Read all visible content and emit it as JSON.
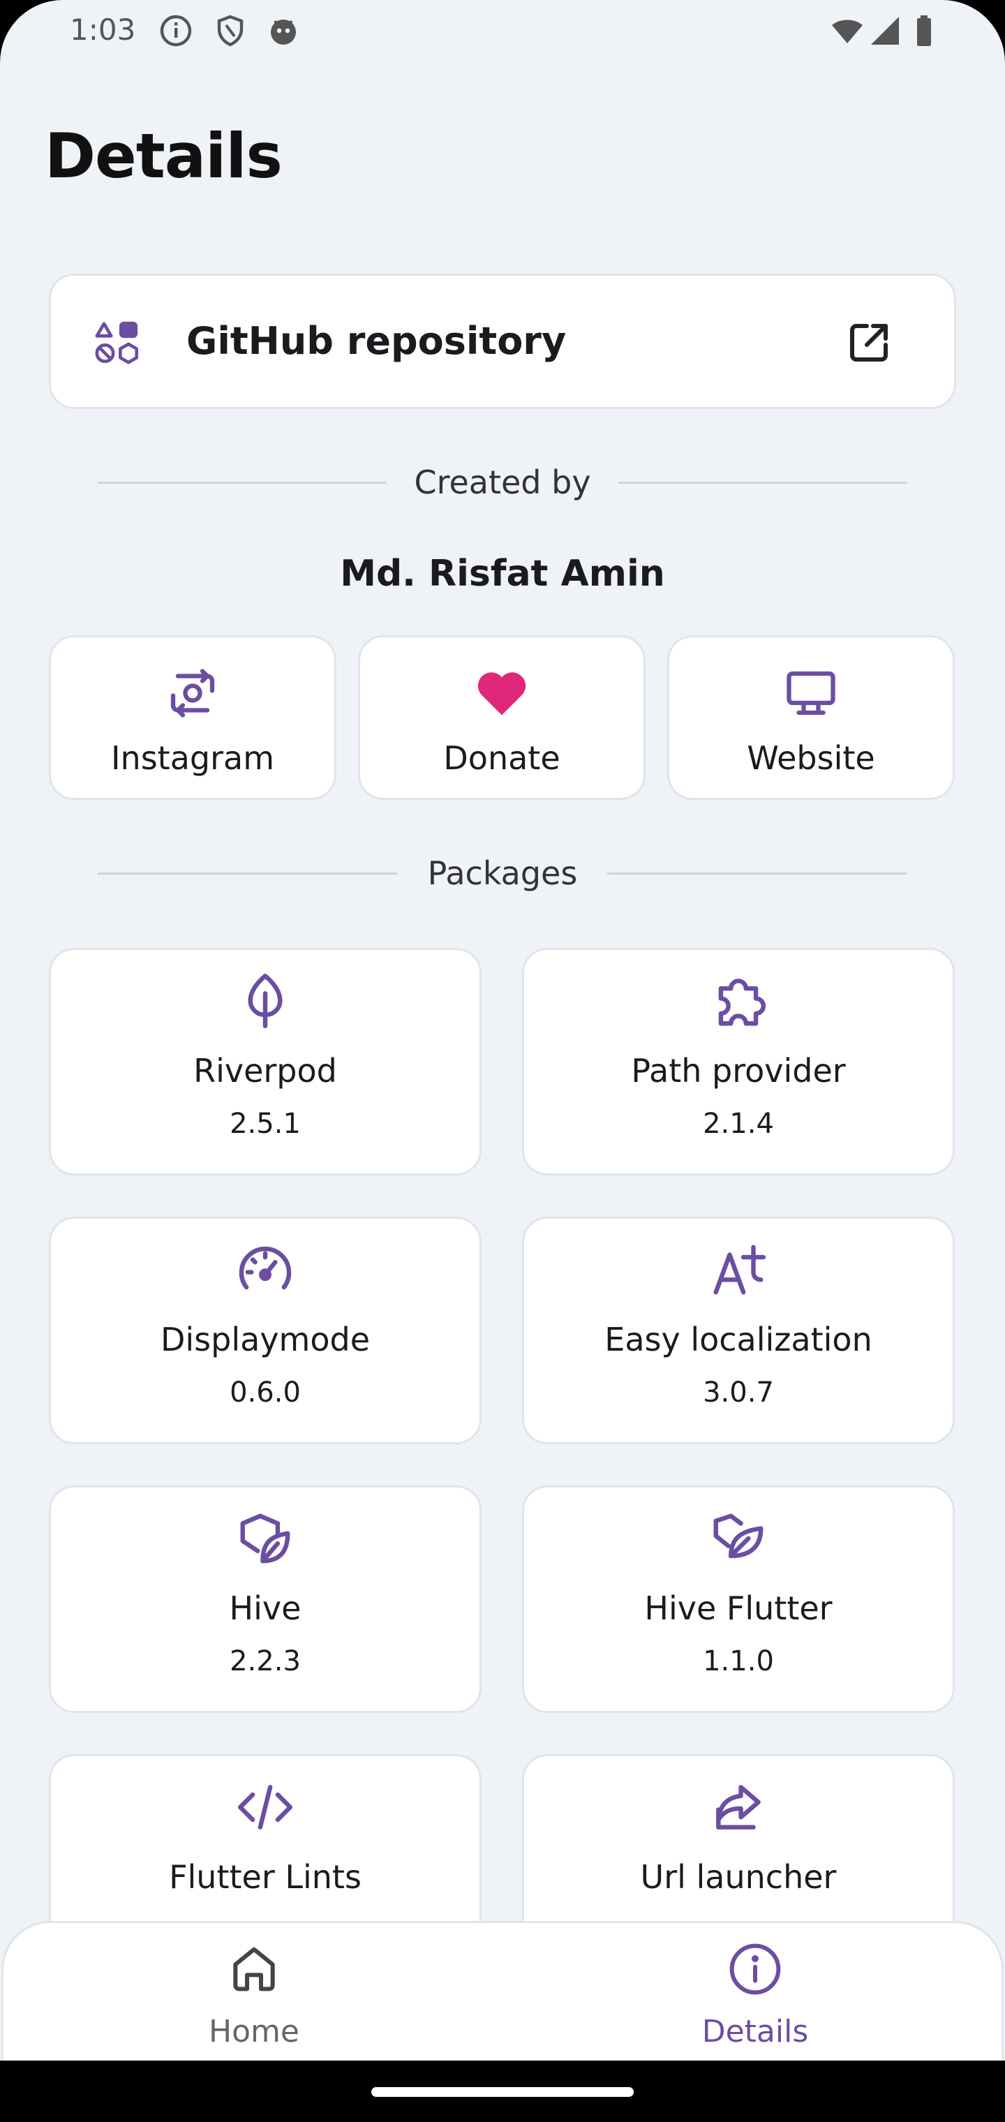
{
  "status_bar": {
    "time": "1:03"
  },
  "page": {
    "title": "Details"
  },
  "repo": {
    "label": "GitHub repository"
  },
  "created_by": {
    "heading": "Created by",
    "author": "Md. Risfat Amin"
  },
  "social": [
    {
      "label": "Instagram",
      "icon": "instagram-icon"
    },
    {
      "label": "Donate",
      "icon": "heart-icon"
    },
    {
      "label": "Website",
      "icon": "monitor-icon"
    }
  ],
  "packages_heading": "Packages",
  "packages": [
    {
      "name": "Riverpod",
      "version": "2.5.1",
      "icon": "leaf-icon"
    },
    {
      "name": "Path provider",
      "version": "2.1.4",
      "icon": "puzzle-icon"
    },
    {
      "name": "Displaymode",
      "version": "0.6.0",
      "icon": "gauge-icon"
    },
    {
      "name": "Easy localization",
      "version": "3.0.7",
      "icon": "translate-icon"
    },
    {
      "name": "Hive",
      "version": "2.2.3",
      "icon": "hive-icon"
    },
    {
      "name": "Hive Flutter",
      "version": "1.1.0",
      "icon": "hive-flutter-icon"
    },
    {
      "name": "Flutter Lints",
      "version": "",
      "icon": "code-icon"
    },
    {
      "name": "Url launcher",
      "version": "",
      "icon": "share-icon"
    }
  ],
  "nav": {
    "home": "Home",
    "details": "Details"
  },
  "colors": {
    "accent": "#6b4ea2",
    "heart": "#e0287a",
    "background": "#eff2f7"
  }
}
